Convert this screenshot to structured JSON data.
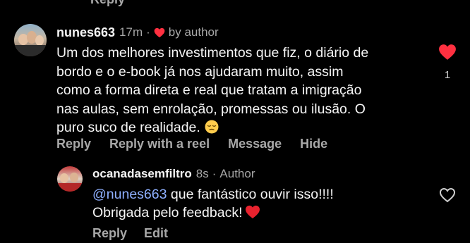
{
  "previous_action_cut": "Reply",
  "comment": {
    "username": "nunes663",
    "timestamp": "17m",
    "separator": "·",
    "liked_by": "by author",
    "text_lines": [
      "Um dos melhores investimentos que fiz, o diário de",
      "bordo e o e-book já nos ajudaram muito, assim",
      "como a forma direta e real que tratam a imigração",
      "nas aulas, sem enrolação, promessas ou ilusão. O",
      "puro suco de realidade."
    ],
    "emoji": "relieved-face-emoji",
    "like_count": "1",
    "liked": true,
    "actions": {
      "reply": "Reply",
      "reply_with_reel": "Reply with a reel",
      "message": "Message",
      "hide": "Hide"
    }
  },
  "reply": {
    "username": "ocanadasemfiltro",
    "timestamp": "8s",
    "separator": "·",
    "author_label": "Author",
    "mention": "@nunes663",
    "text_after_mention": " que fantástico ouvir isso!!!!",
    "text_line2": "Obrigada pelo feedback!",
    "emoji": "red-heart-emoji",
    "liked": false,
    "actions": {
      "reply": "Reply",
      "edit": "Edit"
    }
  },
  "colors": {
    "background": "#000000",
    "text_primary": "#f5f5f5",
    "text_secondary": "#a8a8a8",
    "like_red": "#ff3040",
    "mention_blue": "#8fb0ff"
  }
}
